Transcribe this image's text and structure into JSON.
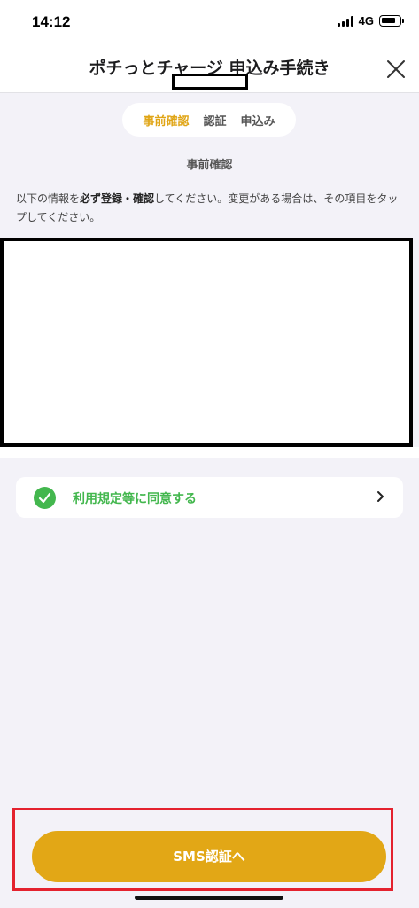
{
  "status_bar": {
    "time": "14:12",
    "network": "4G"
  },
  "header": {
    "title": "ポチっとチャージ 申込み手続き",
    "close_icon": "close-icon"
  },
  "steps": [
    {
      "label": "事前確認",
      "active": true
    },
    {
      "label": "認証",
      "active": false
    },
    {
      "label": "申込み",
      "active": false
    }
  ],
  "colors": {
    "accent": "#e2a716",
    "active_step": "#e0a515",
    "success": "#43b74e",
    "highlight_border": "#e4222e",
    "background": "#f3f2f8"
  },
  "section": {
    "heading": "事前確認",
    "text_prefix": "以下の情報を",
    "text_bold": "必ず登録・確認",
    "text_suffix": "してください。変更がある場合は、その項目をタップしてください。"
  },
  "agreement": {
    "label": "利用規定等に同意する",
    "checked": true,
    "icon": "check-icon",
    "chevron": "chevron-right-icon"
  },
  "cta": {
    "label": "SMS認証へ"
  }
}
